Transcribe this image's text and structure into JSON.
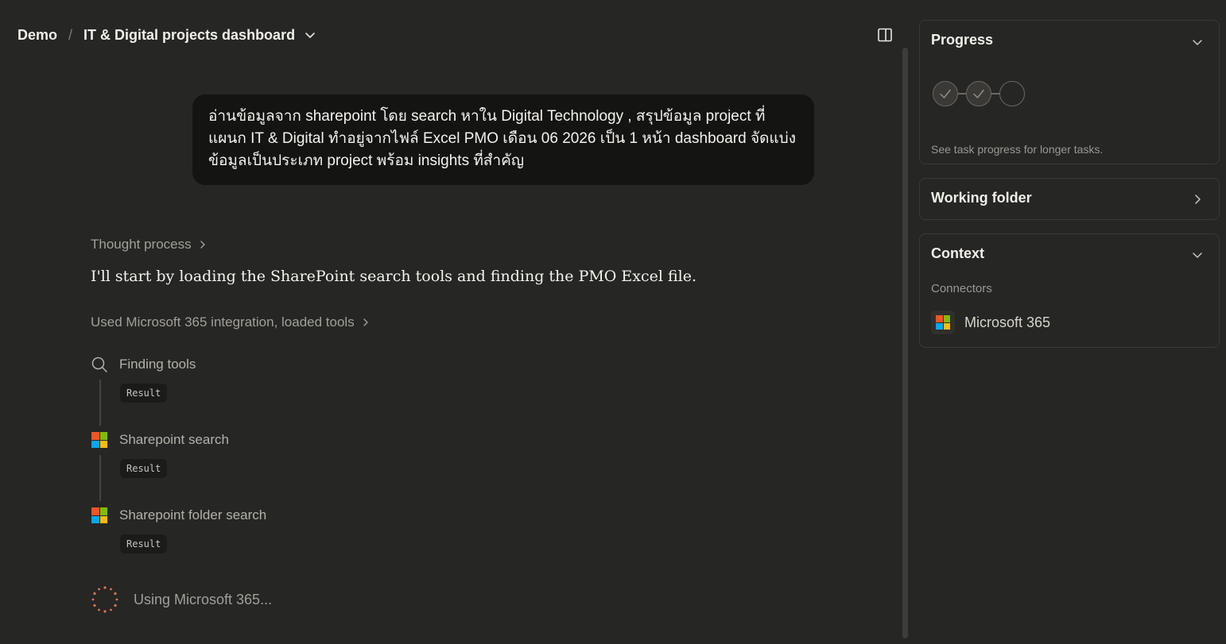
{
  "header": {
    "breadcrumb_root": "Demo",
    "breadcrumb_separator": "/",
    "project_title": "IT & Digital projects dashboard",
    "project_menu_icon": "chevron-down-icon",
    "sidebar_toggle_icon": "sidebar-toggle-icon"
  },
  "conversation": {
    "user_message": "อ่านข้อมูลจาก sharepoint โดย search หาใน Digital Technology , สรุปข้อมูล project ที่แผนก IT & Digital ทำอยู่จากไฟล์ Excel PMO เดือน 06 2026 เป็น 1 หน้า dashboard จัดแบ่งข้อมูลเป็นประเภท project พร้อม insights ที่สำคัญ",
    "thought_process_label": "Thought process",
    "assistant_message": "I'll start by loading the SharePoint search tools and finding the PMO Excel file.",
    "tools_summary_label": "Used Microsoft 365 integration, loaded tools",
    "tool_steps": [
      {
        "label": "Finding tools",
        "icon": "search-icon",
        "result_label": "Result"
      },
      {
        "label": "Sharepoint search",
        "icon": "microsoft-icon",
        "result_label": "Result"
      },
      {
        "label": "Sharepoint folder search",
        "icon": "microsoft-icon",
        "result_label": "Result"
      }
    ],
    "status_text": "Using Microsoft 365...",
    "status_icon": "loading-spinner-icon"
  },
  "right_panel": {
    "progress": {
      "title": "Progress",
      "steps_completed": 2,
      "steps_total": 3,
      "caption": "See task progress for longer tasks."
    },
    "working_folder": {
      "title": "Working folder"
    },
    "context": {
      "title": "Context",
      "connectors_label": "Connectors",
      "connectors": [
        {
          "name": "Microsoft 365",
          "icon": "microsoft-icon"
        }
      ]
    }
  },
  "colors": {
    "background": "#262624",
    "user_bubble": "#141413",
    "spinner_accent": "#d97757",
    "ms_red": "#f35325",
    "ms_green": "#81bc06",
    "ms_blue": "#05a6f0",
    "ms_yellow": "#ffba08"
  }
}
